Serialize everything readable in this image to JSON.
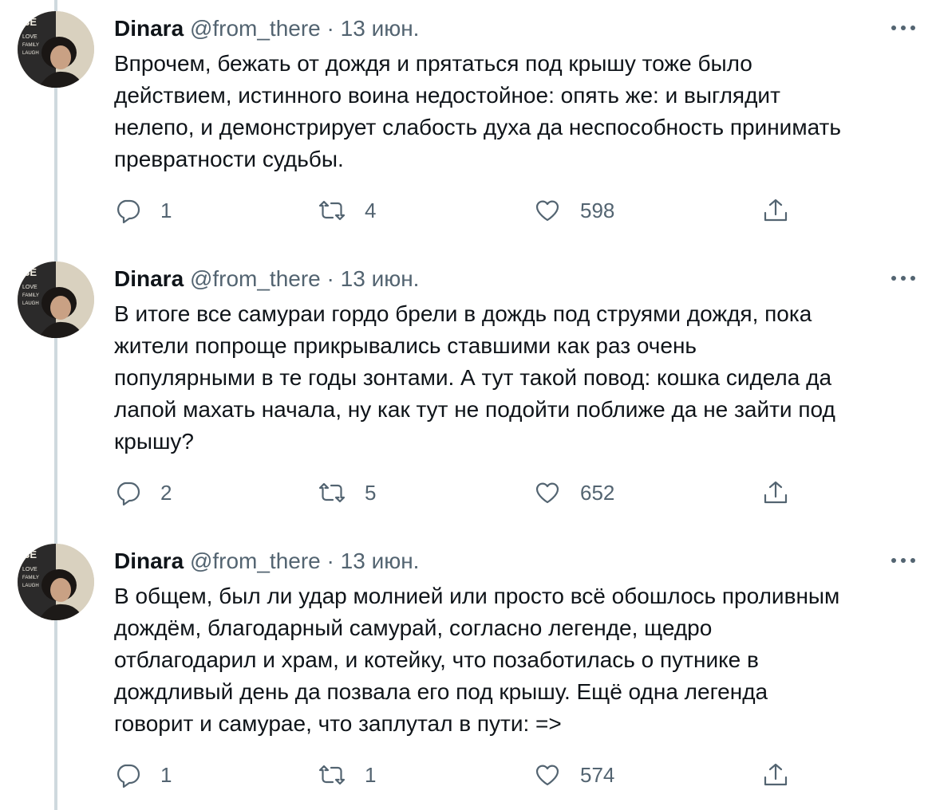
{
  "tweets": [
    {
      "author_name": "Dinara",
      "author_handle": "@from_there",
      "separator": "·",
      "date": "13 июн.",
      "text_lines": [
        "Впрочем, бежать от дождя и прятаться под крышу тоже было",
        "действием, истинного воина недостойное: опять же: и выглядит",
        "нелепо, и демонстрирует слабость духа да неспособность принимать",
        "превратности судьбы."
      ],
      "replies": "1",
      "retweets": "4",
      "likes": "598"
    },
    {
      "author_name": "Dinara",
      "author_handle": "@from_there",
      "separator": "·",
      "date": "13 июн.",
      "text_lines": [
        "В итоге все самураи гордо брели в дождь под струями дождя, пока",
        "жители попроще прикрывались ставшими как раз очень",
        "популярными в те годы зонтами. А тут такой повод: кошка сидела да",
        "лапой махать начала, ну как тут не подойти поближе да не зайти под",
        "крышу?"
      ],
      "replies": "2",
      "retweets": "5",
      "likes": "652"
    },
    {
      "author_name": "Dinara",
      "author_handle": "@from_there",
      "separator": "·",
      "date": "13 июн.",
      "text_lines": [
        "В общем, был ли удар молнией или просто всё обошлось проливным",
        "дождём, благодарный самурай, согласно легенде, щедро",
        "отблагодарил и храм, и котейку, что позаботилась о путнике в",
        "дождливый день да позвала его под крышу. Ещё одна легенда",
        "говорит и самурае, что заплутал в пути: =>"
      ],
      "replies": "1",
      "retweets": "1",
      "likes": "574"
    }
  ],
  "avatar_poster_text": [
    "BE",
    "LOVE",
    "FAMILY",
    "LAUGH"
  ],
  "colors": {
    "text": "#0f1419",
    "secondary": "#536471",
    "thread_line": "#cfd9de",
    "background": "#ffffff"
  },
  "icons": {
    "reply": "reply-icon",
    "retweet": "retweet-icon",
    "like": "heart-icon",
    "share": "share-icon",
    "more": "more-dots-icon"
  }
}
